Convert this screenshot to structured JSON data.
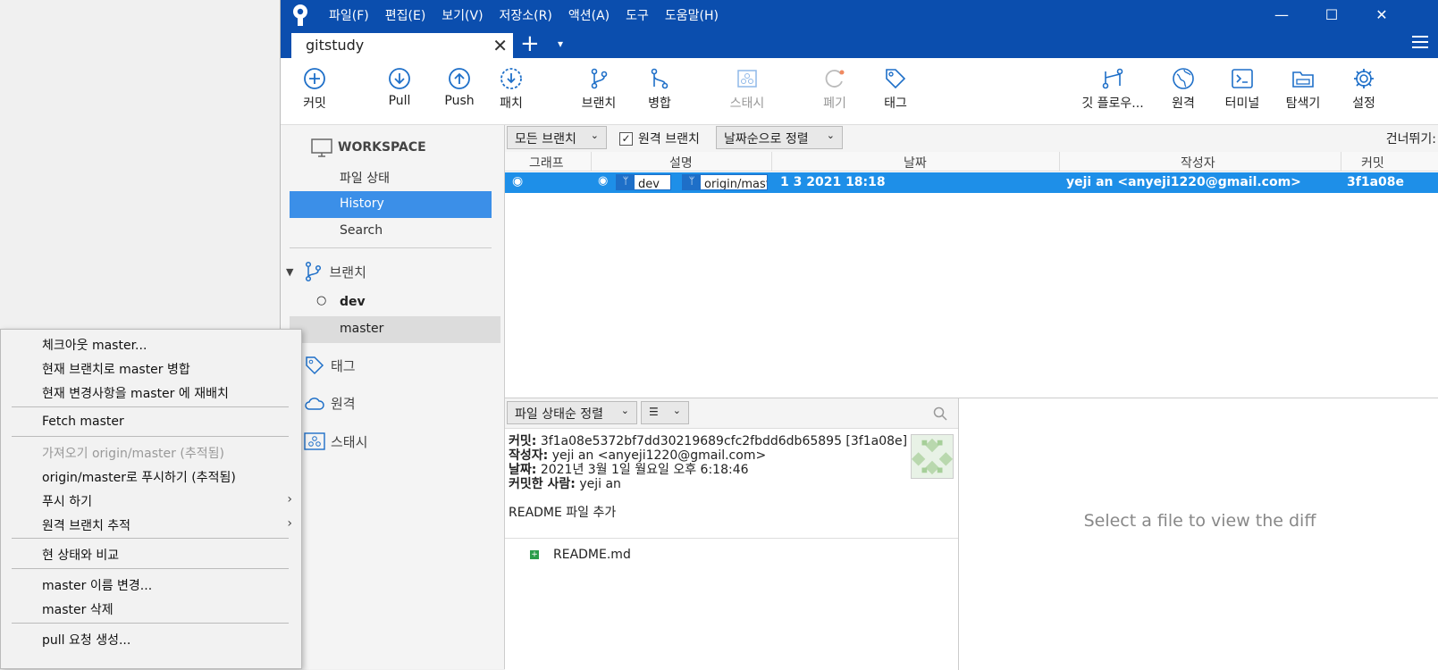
{
  "menu_bar": [
    "파일(F)",
    "편집(E)",
    "보기(V)",
    "저장소(R)",
    "액션(A)",
    "도구",
    "도움말(H)"
  ],
  "window": {
    "minimize": "—",
    "maximize": "☐",
    "close": "✕"
  },
  "tab": {
    "title": "gitstudy",
    "close": "✕",
    "new": "+",
    "dropdown": "▾"
  },
  "toolbar": {
    "commit": "커밋",
    "pull": "Pull",
    "push": "Push",
    "patch": "패치",
    "branch": "브랜치",
    "merge": "병합",
    "stash": "스태시",
    "discard": "폐기",
    "tag": "태그",
    "gitflow": "깃 플로우...",
    "remote": "원격",
    "terminal": "터미널",
    "explorer": "탐색기",
    "settings": "설정"
  },
  "sidebar": {
    "workspace": "WORKSPACE",
    "file_status": "파일 상태",
    "history": "History",
    "search": "Search",
    "branches": "브랜치",
    "branch_dev": "dev",
    "branch_master": "master",
    "tags": "태그",
    "remotes": "원격",
    "stashes": "스태시"
  },
  "filter": {
    "all_branches": "모든 브랜치",
    "remote_branches": "원격 브랜치",
    "sort": "날짜순으로 정렬",
    "skip": "건너뛰기:"
  },
  "columns": {
    "graph": "그래프",
    "description": "설명",
    "date": "날짜",
    "author": "작성자",
    "commit": "커밋"
  },
  "commit_row": {
    "tag_dev": "dev",
    "tag_origin": "origin/mast",
    "date": "1 3 2021 18:18",
    "author": "yeji an <anyeji1220@gmail.com>",
    "hash": "3f1a08e"
  },
  "details": {
    "sort": "파일 상태순 정렬",
    "commit_label": "커밋:",
    "commit_value": "3f1a08e5372bf7dd30219689cfc2fbdd6db65895 [3f1a08e]",
    "author_label": "작성자:",
    "author_value": "yeji an <anyeji1220@gmail.com>",
    "date_label": "날짜:",
    "date_value": "2021년 3월 1일 월요일 오후 6:18:46",
    "committer_label": "커밋한 사람:",
    "committer_value": "yeji an",
    "message": "README 파일 추가",
    "file": "README.md",
    "diff_placeholder": "Select a file to view the diff"
  },
  "context_menu": {
    "checkout": "체크아웃 master...",
    "merge": "현재 브랜치로 master 병합",
    "rebase": "현재 변경사항을 master 에 재배치",
    "fetch": "Fetch master",
    "pull_tracked": "가져오기 origin/master (추적됨)",
    "push_tracked": "origin/master로 푸시하기 (추적됨)",
    "push": "푸시 하기",
    "track_remote": "원격 브랜치 추적",
    "compare": "현 상태와 비교",
    "rename": "master 이름 변경...",
    "delete": "master 삭제",
    "pull_request": "pull 요청 생성..."
  },
  "colors": {
    "title_blue": "#0b4eae",
    "selection_blue": "#1e8fe8",
    "sidebar_selected": "#3b8fe8"
  }
}
